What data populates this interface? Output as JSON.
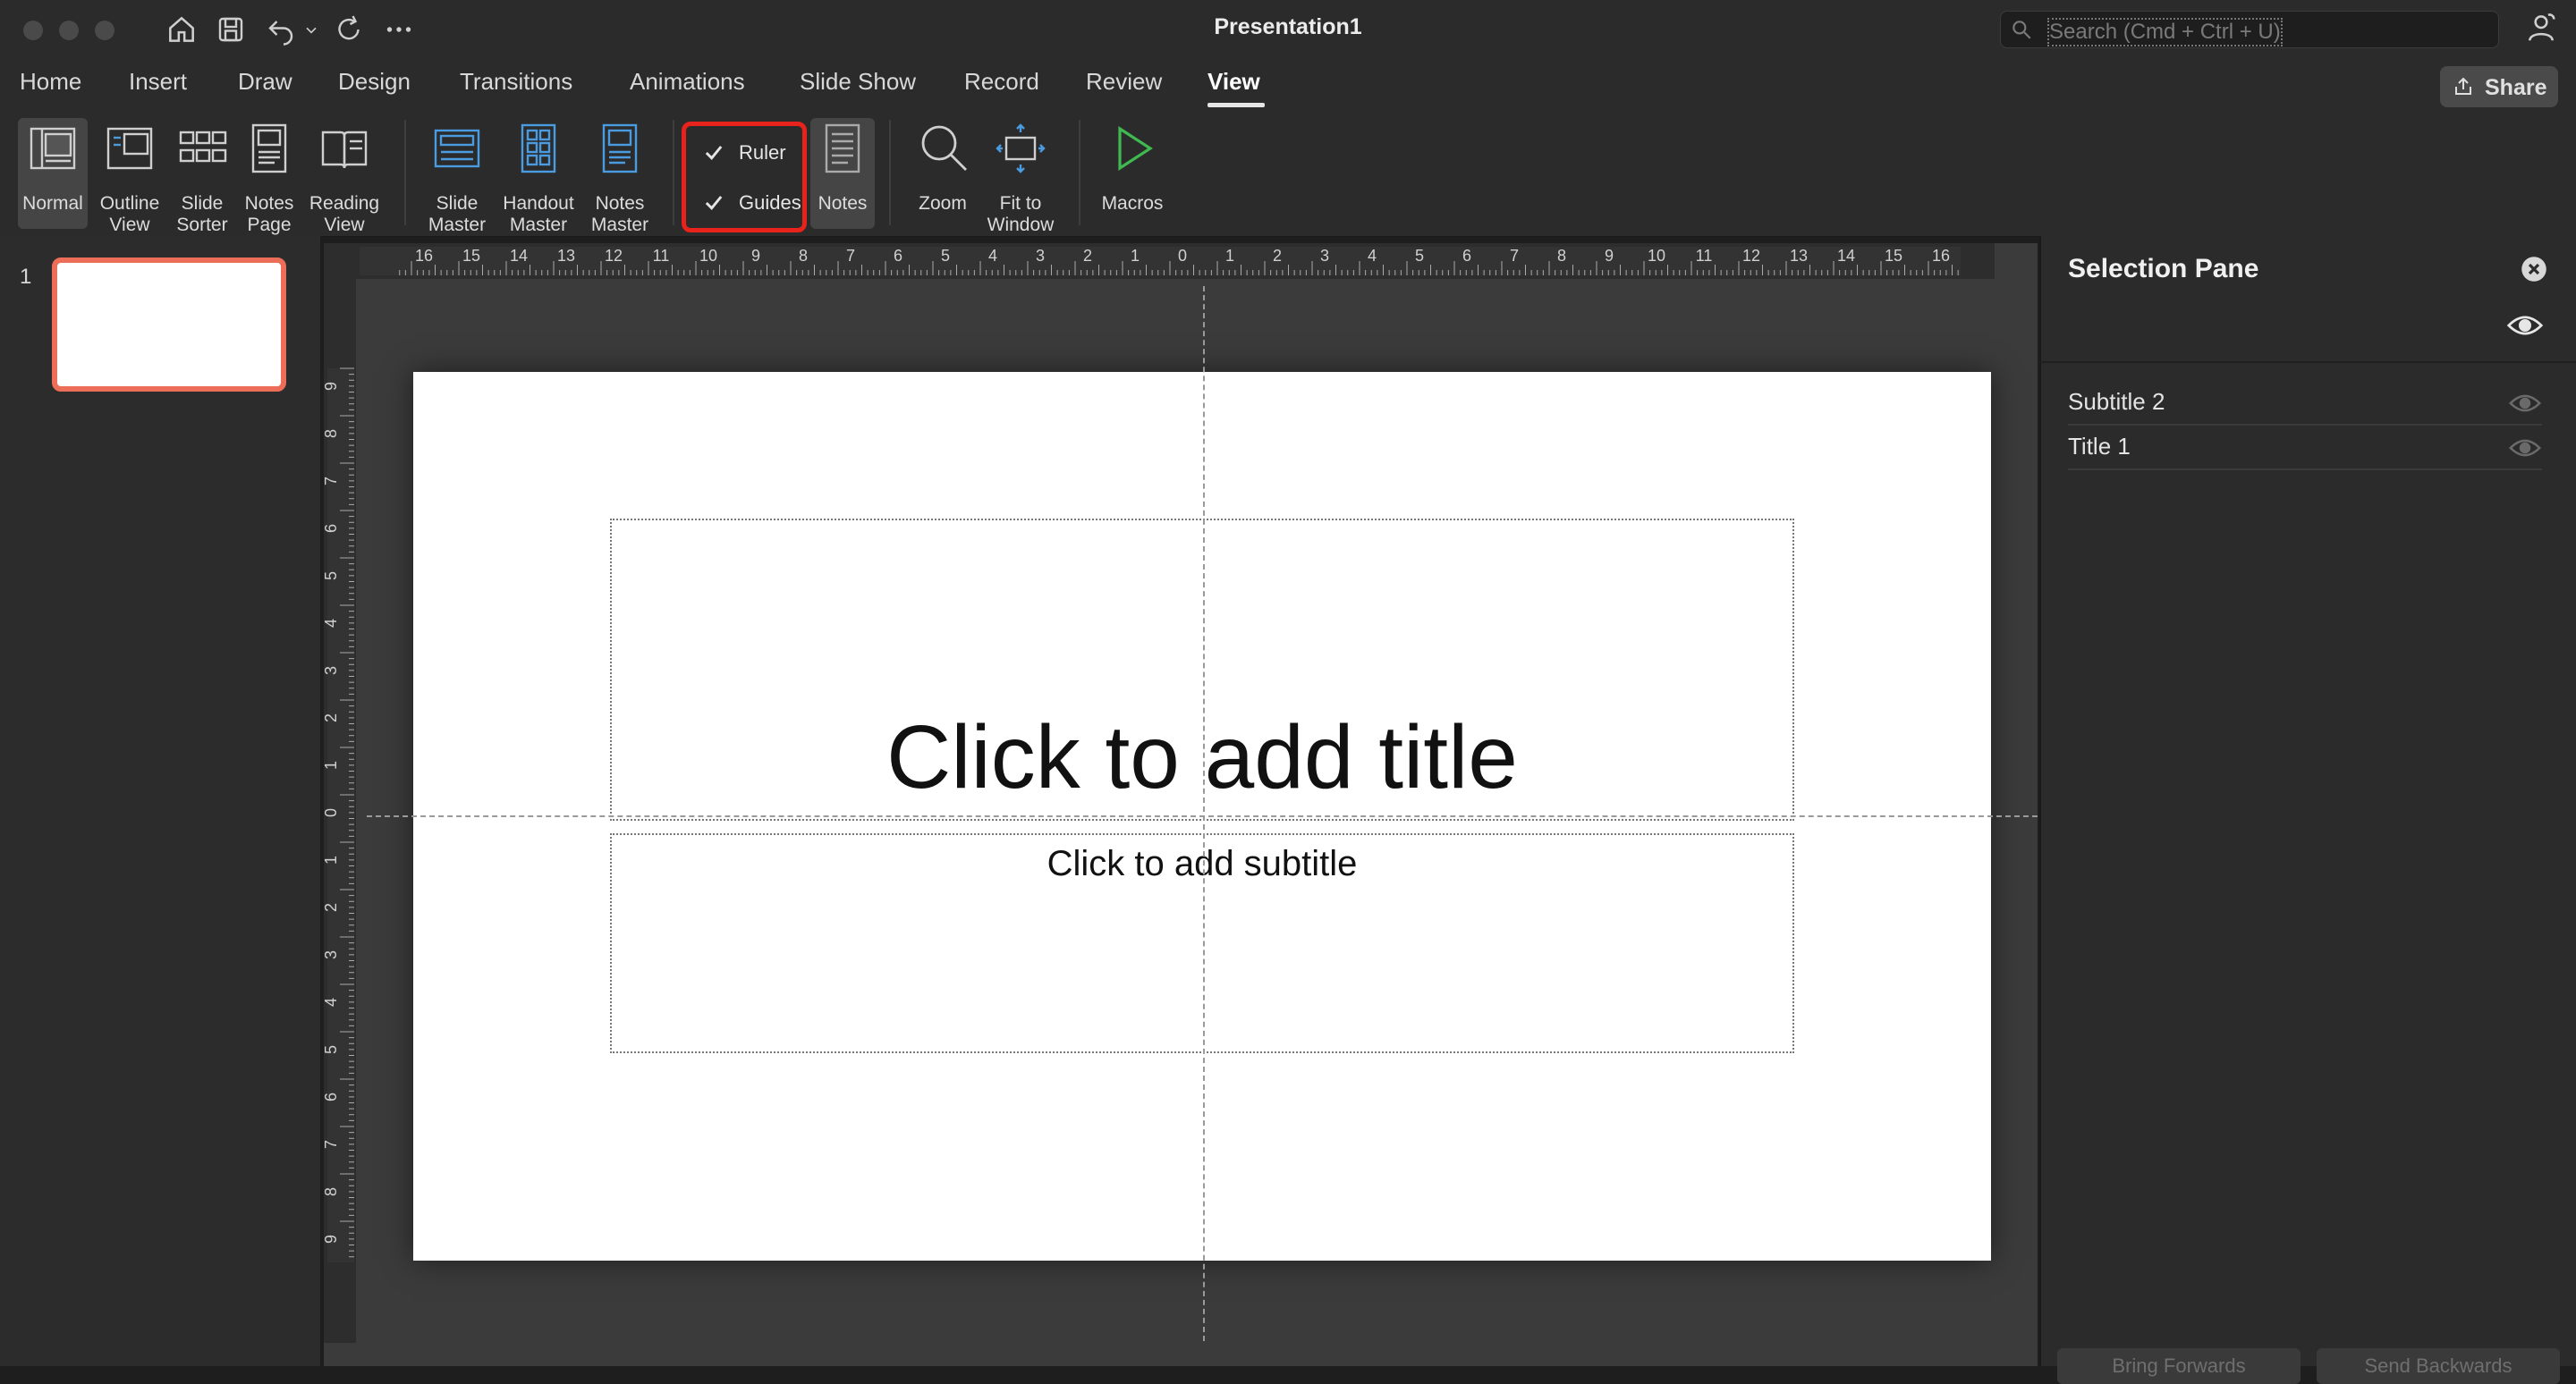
{
  "window": {
    "title": "Presentation1"
  },
  "search": {
    "placeholder": "Search (Cmd + Ctrl + U)"
  },
  "tabs": [
    "Home",
    "Insert",
    "Draw",
    "Design",
    "Transitions",
    "Animations",
    "Slide Show",
    "Record",
    "Review",
    "View"
  ],
  "active_tab": "View",
  "share_label": "Share",
  "ribbon": {
    "presentation_views": [
      "Normal",
      "Outline\nView",
      "Slide\nSorter",
      "Notes\nPage",
      "Reading\nView"
    ],
    "master_views": [
      "Slide\nMaster",
      "Handout\nMaster",
      "Notes\nMaster"
    ],
    "show": {
      "ruler": "Ruler",
      "guides": "Guides",
      "notes": "Notes"
    },
    "zoom": {
      "zoom": "Zoom",
      "fit": "Fit to\nWindow"
    },
    "macros": "Macros"
  },
  "thumbnails": {
    "slide_number": "1"
  },
  "ruler": {
    "h_labels": [
      "16",
      "15",
      "14",
      "13",
      "12",
      "11",
      "10",
      "9",
      "8",
      "7",
      "6",
      "5",
      "4",
      "3",
      "2",
      "1",
      "0",
      "1",
      "2",
      "3",
      "4",
      "5",
      "6",
      "7",
      "8",
      "9",
      "10",
      "11",
      "12",
      "13",
      "14",
      "15",
      "16"
    ],
    "v_labels": [
      "9",
      "8",
      "7",
      "6",
      "5",
      "4",
      "3",
      "2",
      "1",
      "0",
      "1",
      "2",
      "3",
      "4",
      "5",
      "6",
      "7",
      "8",
      "9"
    ]
  },
  "slide": {
    "title_placeholder": "Click to add title",
    "subtitle_placeholder": "Click to add subtitle"
  },
  "selection_pane": {
    "title": "Selection Pane",
    "items": [
      "Subtitle 2",
      "Title 1"
    ],
    "bring_forwards": "Bring Forwards",
    "send_backwards": "Send Backwards"
  },
  "colors": {
    "highlight": "#e8231c",
    "thumb_border": "#ec6d58",
    "macros_green": "#3fb950",
    "icon_blue": "#4a9be0"
  }
}
